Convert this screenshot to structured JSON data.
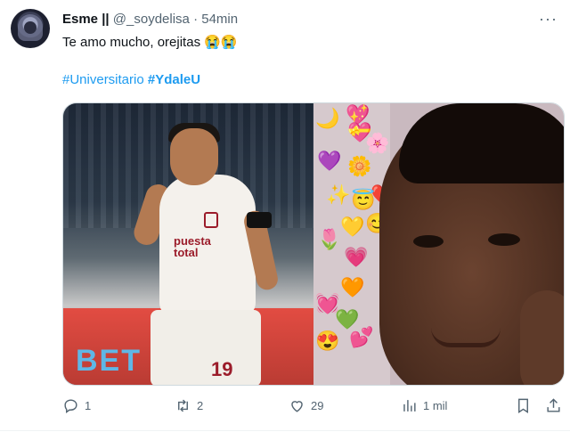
{
  "tweet": {
    "author_name": "Esme",
    "name_suffix": "||",
    "handle": "@_soydelisa",
    "dot": "·",
    "time": "54min",
    "text": "Te amo mucho, orejitas 😭😭",
    "hashtags": [
      "#Universitario",
      "#YdaleU"
    ],
    "media": {
      "left_photo": {
        "sponsor_line1": "puesta",
        "sponsor_line2": "total",
        "shirt_number": "19",
        "banner_text": "BET"
      },
      "right_photo": {
        "emojis": [
          "🌙",
          "💖",
          "🌸",
          "💝",
          "💜",
          "🌼",
          "❤️",
          "✨",
          "😇",
          "🌷",
          "😊",
          "💛",
          "💗",
          "🧡",
          "💚",
          "💓",
          "😍",
          "💕"
        ]
      }
    },
    "actions": {
      "replies": "1",
      "retweets": "2",
      "likes": "29",
      "views": "1 mil"
    },
    "more_label": "···"
  },
  "colors": {
    "accent": "#1d9bf0",
    "muted": "#536471",
    "text": "#0f1419"
  }
}
